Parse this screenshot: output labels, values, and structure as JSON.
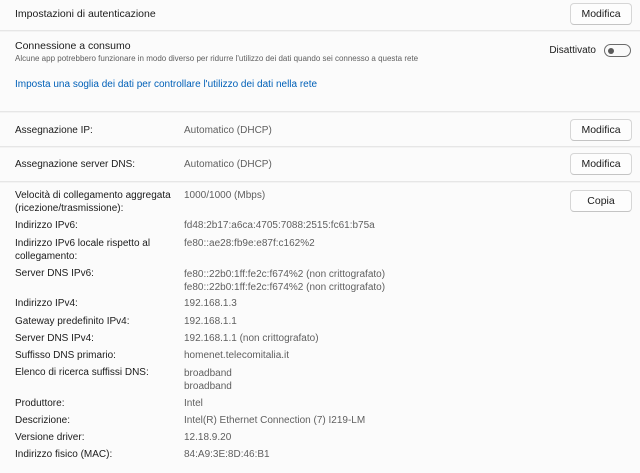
{
  "auth": {
    "title": "Impostazioni di autenticazione",
    "button": "Modifica"
  },
  "metered": {
    "title": "Connessione a consumo",
    "description": "Alcune app potrebbero funzionare in modo diverso per ridurre l'utilizzo dei dati quando sei connesso a questa rete",
    "toggle_state": "Disattivato",
    "toggle_on": false,
    "link": "Imposta una soglia dei dati per controllare l'utilizzo dei dati nella rete"
  },
  "ip": {
    "label": "Assegnazione IP:",
    "value": "Automatico (DHCP)",
    "button": "Modifica"
  },
  "dns": {
    "label": "Assegnazione server DNS:",
    "value": "Automatico (DHCP)",
    "button": "Modifica"
  },
  "props": {
    "copy_button": "Copia",
    "link_speed_label_1": "Velocità di collegamento aggregata",
    "link_speed_label_2": "(ricezione/trasmissione):",
    "link_speed_value": "1000/1000 (Mbps)",
    "ipv6_label": "Indirizzo IPv6:",
    "ipv6_value": "fd48:2b17:a6ca:4705:7088:2515:fc61:b75a",
    "ipv6_local_label_1": "Indirizzo IPv6 locale rispetto al",
    "ipv6_local_label_2": "collegamento:",
    "ipv6_local_value": "fe80::ae28:fb9e:e87f:c162%2",
    "dns6_label": "Server DNS IPv6:",
    "dns6_value_1": "fe80::22b0:1ff:fe2c:f674%2 (non crittografato)",
    "dns6_value_2": "fe80::22b0:1ff:fe2c:f674%2 (non crittografato)",
    "ipv4_label": "Indirizzo IPv4:",
    "ipv4_value": "192.168.1.3",
    "gateway_label": "Gateway predefinito IPv4:",
    "gateway_value": "192.168.1.1",
    "dns4_label": "Server DNS IPv4:",
    "dns4_value": "192.168.1.1 (non crittografato)",
    "suffix_label": "Suffisso DNS primario:",
    "suffix_value": "homenet.telecomitalia.it",
    "search_label": "Elenco di ricerca suffissi DNS:",
    "search_value_1": "broadband",
    "search_value_2": "broadband",
    "manufacturer_label": "Produttore:",
    "manufacturer_value": "Intel",
    "description_label": "Descrizione:",
    "description_value": "Intel(R) Ethernet Connection (7) I219-LM",
    "driver_label": "Versione driver:",
    "driver_value": "12.18.9.20",
    "mac_label": "Indirizzo fisico (MAC):",
    "mac_value": "84:A9:3E:8D:46:B1"
  }
}
